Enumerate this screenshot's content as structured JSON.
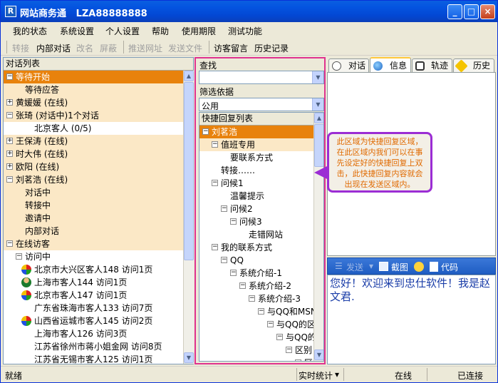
{
  "window": {
    "title": "网站商务通   LZA88888888",
    "icon_glyph": "R",
    "minimize": "_",
    "maximize": "□",
    "close": "×"
  },
  "menu": [
    "我的状态",
    "系统设置",
    "个人设置",
    "帮助",
    "使用期限",
    "测试功能"
  ],
  "toolbar": {
    "transfer": "转接",
    "internal_chat": "内部对话",
    "rename": "改名",
    "block": "屏蔽",
    "push_url": "推送网址",
    "send_file": "发送文件",
    "visitor_message": "访客留言",
    "history": "历史记录"
  },
  "left_panel": {
    "header": "对话列表",
    "rows": [
      {
        "text": "等待开始",
        "pm": "−",
        "indent": 0,
        "style": "sel"
      },
      {
        "text": "等待应答",
        "pm": "",
        "indent": 2,
        "style": "hl"
      },
      {
        "text": "黄媛媛 (在线)",
        "pm": "+",
        "indent": 0,
        "style": "hl"
      },
      {
        "text": "张琦 (对话中)1个对话",
        "pm": "−",
        "indent": 0,
        "style": "hl"
      },
      {
        "text": "北京客人 (0/5)",
        "pm": "",
        "indent": 3,
        "style": ""
      },
      {
        "text": "王保涛 (在线)",
        "pm": "+",
        "indent": 0,
        "style": "hl"
      },
      {
        "text": "时大伟 (在线)",
        "pm": "+",
        "indent": 0,
        "style": "hl"
      },
      {
        "text": "欧阳 (在线)",
        "pm": "+",
        "indent": 0,
        "style": "hl"
      },
      {
        "text": "刘茗浩 (在线)",
        "pm": "−",
        "indent": 0,
        "style": "hl"
      },
      {
        "text": "对话中",
        "pm": "",
        "indent": 2,
        "style": "hl"
      },
      {
        "text": "转接中",
        "pm": "",
        "indent": 2,
        "style": "hl"
      },
      {
        "text": "邀请中",
        "pm": "",
        "indent": 2,
        "style": "hl"
      },
      {
        "text": "内部对话",
        "pm": "",
        "indent": 2,
        "style": "hl"
      },
      {
        "text": "在线访客",
        "pm": "−",
        "indent": 0,
        "style": "hl"
      },
      {
        "text": "访问中",
        "pm": "−",
        "indent": 1,
        "style": ""
      },
      {
        "text": "北京市大兴区客人148 访问1页",
        "pm": "",
        "indent": 3,
        "style": "",
        "icon": "multi"
      },
      {
        "text": "上海市客人144 访问1页",
        "pm": "",
        "indent": 3,
        "style": "",
        "icon": "person"
      },
      {
        "text": "北京市客人147 访问1页",
        "pm": "",
        "indent": 3,
        "style": "",
        "icon": "multi"
      },
      {
        "text": "广东省珠海市客人133 访问7页",
        "pm": "",
        "indent": 3,
        "style": "",
        "icon": "none"
      },
      {
        "text": "山西省运城市客人145 访问2页",
        "pm": "",
        "indent": 3,
        "style": "",
        "icon": "multi"
      },
      {
        "text": "上海市客人126 访问3页",
        "pm": "",
        "indent": 3,
        "style": "",
        "icon": "none"
      },
      {
        "text": "江苏省徐州市蒋小姐金网 访问8页",
        "pm": "",
        "indent": 3,
        "style": "",
        "icon": "none"
      },
      {
        "text": "江苏省无锡市客人125 访问1页",
        "pm": "",
        "indent": 3,
        "style": "",
        "icon": "none"
      }
    ]
  },
  "middle_panel": {
    "search_label": "查找",
    "search_value": "",
    "filter_label": "筛选依据",
    "filter_value": "公用",
    "list_header": "快捷回复列表",
    "rows": [
      {
        "text": "刘茗浩",
        "pm": "−",
        "indent": 0,
        "style": "sel"
      },
      {
        "text": "值班专用",
        "pm": "−",
        "indent": 1,
        "style": "hl"
      },
      {
        "text": "要联系方式",
        "pm": "",
        "indent": 3,
        "style": ""
      },
      {
        "text": "转接……",
        "pm": "",
        "indent": 2,
        "style": ""
      },
      {
        "text": "问候1",
        "pm": "−",
        "indent": 1,
        "style": ""
      },
      {
        "text": "温馨提示",
        "pm": "",
        "indent": 3,
        "style": ""
      },
      {
        "text": "问候2",
        "pm": "−",
        "indent": 2,
        "style": ""
      },
      {
        "text": "问候3",
        "pm": "−",
        "indent": 3,
        "style": ""
      },
      {
        "text": "走错网站",
        "pm": "",
        "indent": 5,
        "style": ""
      },
      {
        "text": "我的联系方式",
        "pm": "−",
        "indent": 1,
        "style": ""
      },
      {
        "text": "QQ",
        "pm": "−",
        "indent": 2,
        "style": ""
      },
      {
        "text": "系统介绍-1",
        "pm": "−",
        "indent": 3,
        "style": ""
      },
      {
        "text": "系统介绍-2",
        "pm": "−",
        "indent": 4,
        "style": ""
      },
      {
        "text": "系统介绍-3",
        "pm": "−",
        "indent": 5,
        "style": ""
      },
      {
        "text": "与QQ和MSN的",
        "pm": "−",
        "indent": 6,
        "style": ""
      },
      {
        "text": "与QQ的区",
        "pm": "−",
        "indent": 7,
        "style": ""
      },
      {
        "text": "与QQ的",
        "pm": "−",
        "indent": 8,
        "style": ""
      },
      {
        "text": "区别",
        "pm": "−",
        "indent": 9,
        "style": ""
      },
      {
        "text": "区",
        "pm": "−",
        "indent": 10,
        "style": ""
      }
    ]
  },
  "right_panel": {
    "tabs": [
      {
        "label": "对话",
        "icon": "chat-icon"
      },
      {
        "label": "信息",
        "icon": "globe-icon"
      },
      {
        "label": "轨迹",
        "icon": "track-icon"
      },
      {
        "label": "历史",
        "icon": "star-icon"
      }
    ],
    "send_bar": {
      "send": "发送",
      "screenshot": "截图",
      "code": "代码"
    },
    "message_text": "您好！欢迎来到忠仕软件！我是赵文君."
  },
  "callout": {
    "text": "此区域为快捷回复区域，在此区域内我们可以在事先设定好的快捷回复上双击，此快捷回复内容就会出现在发送区域内。"
  },
  "statusbar": {
    "ready": "就绪",
    "realtime_stats": "实时统计",
    "online": "在线",
    "connected": "已连接"
  },
  "colors": {
    "selected": "#e8820c",
    "highlight": "#fbe8c6",
    "callout_border": "#9b2dd4",
    "callout_text": "#e06a00",
    "middle_border": "#e0338f",
    "message_text": "#1a3da8"
  }
}
